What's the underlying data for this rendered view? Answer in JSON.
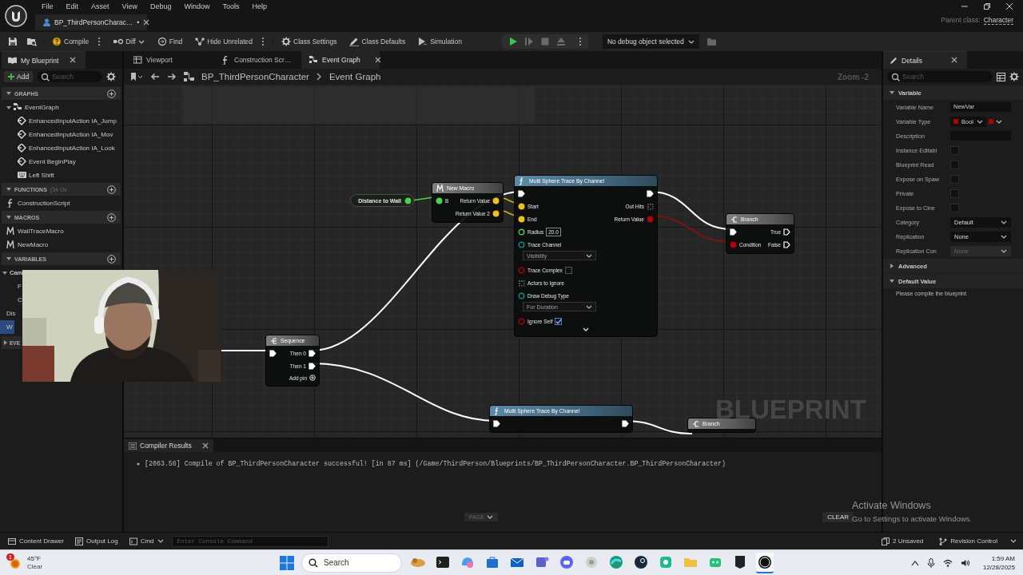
{
  "window": {
    "menu": [
      "File",
      "Edit",
      "Asset",
      "View",
      "Debug",
      "Window",
      "Tools",
      "Help"
    ],
    "document_tab": {
      "title": "BP_ThirdPersonCharac…",
      "unsaved_mark": "•"
    },
    "parent_class_label": "Parent class:",
    "parent_class": "Character"
  },
  "toolbar": {
    "buttons": [
      {
        "kind": "save",
        "options": false,
        "dropdown": false
      },
      {
        "kind": "browse",
        "options": false,
        "dropdown": false
      },
      {
        "kind": "compile",
        "label": "Compile",
        "options": true,
        "dropdown": false
      },
      {
        "kind": "diff",
        "label": "Diff",
        "options": false,
        "dropdown": true
      },
      {
        "kind": "find",
        "label": "Find",
        "options": false,
        "dropdown": false
      },
      {
        "kind": "hide",
        "label": "Hide Unrelated",
        "options": true,
        "dropdown": false
      },
      {
        "kind": "settings",
        "label": "Class Settings",
        "options": false,
        "dropdown": false
      },
      {
        "kind": "defaults",
        "label": "Class Defaults",
        "options": false,
        "dropdown": false
      },
      {
        "kind": "simulation",
        "label": "Simulation",
        "options": false,
        "dropdown": false
      }
    ],
    "play_controls": [
      {
        "kind": "play",
        "disabled": false
      },
      {
        "kind": "step",
        "disabled": true
      },
      {
        "kind": "stop",
        "disabled": true
      },
      {
        "kind": "eject",
        "disabled": true
      }
    ],
    "debug_object": "No debug object selected"
  },
  "my_blueprint": {
    "tab": "My Blueprint",
    "add_button": "Add",
    "search_placeholder": "Search",
    "sections": [
      {
        "title": "GRAPHS",
        "expanded": true,
        "add_button": true,
        "items": [
          {
            "label": "EventGraph",
            "kind": "graph",
            "children": [
              {
                "label": "EnhancedInputAction IA_Jump",
                "kind": "event"
              },
              {
                "label": "EnhancedInputAction IA_Mov",
                "kind": "event"
              },
              {
                "label": "EnhancedInputAction IA_Look",
                "kind": "event"
              },
              {
                "label": "Event BeginPlay",
                "kind": "event"
              },
              {
                "label": "Left Shift",
                "kind": "key"
              }
            ]
          }
        ]
      },
      {
        "title": "FUNCTIONS",
        "note": "(34 Ov",
        "expanded": true,
        "add_button": true,
        "items": [
          {
            "label": "ConstructionScript",
            "kind": "function"
          }
        ]
      },
      {
        "title": "MACROS",
        "expanded": true,
        "add_button": true,
        "items": [
          {
            "label": "WallTraceMacro",
            "kind": "macro"
          },
          {
            "label": "NewMacro",
            "kind": "macro"
          }
        ]
      },
      {
        "title": "VARIABLES",
        "expanded": true,
        "add_button": true,
        "items": [
          {
            "label": "Cam",
            "kind": "category",
            "selected": false,
            "children": [
              {
                "label": "F",
                "kind": "variable",
                "selected": false
              },
              {
                "label": "C",
                "kind": "variable",
                "selected": false
              }
            ]
          },
          {
            "label": "Dis",
            "kind": "variable",
            "selected": false
          },
          {
            "label": "W",
            "kind": "variable",
            "selected": true
          }
        ]
      },
      {
        "title": "EVE",
        "expanded": false,
        "add_button": false
      }
    ]
  },
  "graph": {
    "tabs": [
      {
        "label": "Viewport",
        "kind": "viewport",
        "selected": false
      },
      {
        "label": "Construction Scr…",
        "kind": "function",
        "selected": false
      },
      {
        "label": "Event Graph",
        "kind": "graph",
        "selected": true
      }
    ],
    "breadcrumb": [
      "BP_ThirdPersonCharacter",
      "Event Graph"
    ],
    "zoom": "Zoom -2",
    "watermark": "BLUEPRINT",
    "nodes": [
      {
        "kind": "variable",
        "title": "Distance to Wall",
        "outputs": [
          {
            "kind": "float",
            "connected": true
          }
        ]
      },
      {
        "kind": "macro",
        "title": "New Macro",
        "inputs": [
          {
            "kind": "float",
            "label": "B",
            "connected": true
          }
        ],
        "outputs": [
          {
            "kind": "vector",
            "label": "Return Value",
            "connected": true
          },
          {
            "kind": "vector",
            "label": "Return Value 2",
            "connected": true
          }
        ]
      },
      {
        "kind": "function",
        "title": "Multi Sphere Trace By Channel",
        "expandable": true,
        "inputs": [
          {
            "kind": "exec",
            "connected": true
          },
          {
            "kind": "vector",
            "label": "Start",
            "connected": true
          },
          {
            "kind": "vector",
            "label": "End",
            "connected": true
          },
          {
            "kind": "float",
            "label": "Radius",
            "value": "20.0",
            "connected": false
          },
          {
            "kind": "channel",
            "label": "Trace Channel",
            "choice": "Visibility",
            "connected": false
          },
          {
            "kind": "bool",
            "label": "Trace Complex",
            "checked": false,
            "connected": false
          },
          {
            "kind": "array",
            "label": "Actors to Ignore",
            "connected": false
          },
          {
            "kind": "channel",
            "label": "Draw Debug Type",
            "choice": "For Duration",
            "connected": false
          },
          {
            "kind": "bool",
            "label": "Ignore Self",
            "checked": true,
            "connected": false
          }
        ],
        "outputs": [
          {
            "kind": "exec",
            "connected": true
          },
          {
            "kind": "array",
            "label": "Out Hits",
            "connected": false
          },
          {
            "kind": "bool",
            "label": "Return Value",
            "connected": true
          }
        ]
      },
      {
        "kind": "branch",
        "title": "Branch",
        "inputs": [
          {
            "kind": "exec",
            "connected": true
          },
          {
            "kind": "bool",
            "label": "Condition",
            "connected": true
          }
        ],
        "outputs": [
          {
            "kind": "exec",
            "label": "True",
            "connected": false
          },
          {
            "kind": "exec",
            "label": "False",
            "connected": false
          }
        ]
      },
      {
        "kind": "sequence",
        "title": "Sequence",
        "add_pin": "Add pin",
        "inputs": [
          {
            "kind": "exec",
            "connected": true
          }
        ],
        "outputs": [
          {
            "kind": "exec",
            "label": "Then 0",
            "connected": true
          },
          {
            "kind": "exec",
            "label": "Then 1",
            "connected": true
          }
        ]
      },
      {
        "kind": "function",
        "title": "Multi Sphere Trace By Channel",
        "inputs": [
          {
            "kind": "exec",
            "connected": true
          }
        ],
        "outputs": [
          {
            "kind": "exec",
            "connected": true
          }
        ]
      },
      {
        "kind": "branch",
        "title": "Branch"
      }
    ]
  },
  "compiler": {
    "tab": "Compiler Results",
    "messages": [
      "[2063.56] Compile of BP_ThirdPersonCharacter successful! [in 87 ms] (/Game/ThirdPerson/Blueprints/BP_ThirdPersonCharacter.BP_ThirdPersonCharacter)"
    ],
    "page_button": "PAGE",
    "clear_button": "CLEAR"
  },
  "details": {
    "tab": "Details",
    "search_placeholder": "Search",
    "sections": [
      {
        "title": "Variable",
        "expanded": true,
        "rows": [
          {
            "label": "Variable Name",
            "kind": "text",
            "value": "NewVar"
          },
          {
            "label": "Variable Type",
            "kind": "type",
            "value": "Bool"
          },
          {
            "label": "Description",
            "kind": "text"
          },
          {
            "label": "Instance Editabl",
            "kind": "checkbox",
            "checked": false
          },
          {
            "label": "Blueprint Read",
            "kind": "checkbox",
            "checked": false
          },
          {
            "label": "Expose on Spaw",
            "kind": "checkbox",
            "checked": false
          },
          {
            "label": "Private",
            "kind": "checkbox",
            "checked": false
          },
          {
            "label": "Expose to Cine",
            "kind": "checkbox",
            "checked": false
          },
          {
            "label": "Category",
            "kind": "dropdown",
            "value": "Default",
            "disabled": false
          },
          {
            "label": "Replication",
            "kind": "dropdown",
            "value": "None",
            "disabled": false
          },
          {
            "label": "Replication Con",
            "kind": "dropdown",
            "value": "None",
            "disabled": true
          }
        ]
      },
      {
        "title": "Advanced",
        "expanded": false
      },
      {
        "title": "Default Value",
        "expanded": true,
        "message": "Please compile the blueprint"
      }
    ]
  },
  "os_notice": {
    "title": "Activate Windows",
    "text": "Go to Settings to activate Windows."
  },
  "status_bar": {
    "content_drawer": "Content Drawer",
    "output_log": "Output Log",
    "cmd": "Cmd",
    "console_placeholder": "Enter Console Command",
    "unsaved": "2 Unsaved",
    "revision_control": "Revision Control"
  },
  "taskbar": {
    "weather": {
      "temperature": "45°F",
      "condition": "Clear",
      "badge": "1"
    },
    "search_placeholder": "Search",
    "apps": [
      {
        "kind": "widget",
        "selected": false
      },
      {
        "kind": "terminal",
        "selected": false
      },
      {
        "kind": "copilot",
        "selected": false
      },
      {
        "kind": "store",
        "selected": false
      },
      {
        "kind": "mail",
        "selected": false
      },
      {
        "kind": "teams",
        "selected": false
      },
      {
        "kind": "chat",
        "selected": false
      },
      {
        "kind": "misc",
        "selected": false
      },
      {
        "kind": "browser",
        "selected": false
      },
      {
        "kind": "steam",
        "selected": false
      },
      {
        "kind": "green",
        "selected": false
      },
      {
        "kind": "folder",
        "selected": false
      },
      {
        "kind": "bot",
        "selected": false
      },
      {
        "kind": "epic",
        "selected": false
      },
      {
        "kind": "engine",
        "selected": true
      }
    ],
    "time": "1:59 AM",
    "date": "12/28/2025"
  }
}
